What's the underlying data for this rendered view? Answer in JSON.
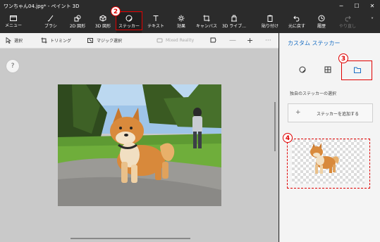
{
  "window": {
    "title": "ワンちゃん04.jpg* - ペイント 3D"
  },
  "ribbon": {
    "menu": "メニュー",
    "brush": "ブラシ",
    "shapes2d": "2D 図形",
    "shapes3d": "3D 図形",
    "stickers": "ステッカー",
    "text": "テキスト",
    "effects": "効果",
    "canvas": "キャンバス",
    "library3d": "3D ライブ...",
    "paste": "貼り付け",
    "undo": "元に戻す",
    "history": "履歴",
    "redo": "やり直し"
  },
  "toolbar": {
    "select": "選択",
    "crop": "トリミング",
    "magic_select": "マジック選択",
    "mixed_reality": "Mixed Reality"
  },
  "panel": {
    "title": "カスタム ステッカー",
    "section_label": "独自のステッカーの選択",
    "add_sticker": "ステッカーを追加する"
  },
  "markers": [
    "2",
    "3",
    "4"
  ],
  "help": "?",
  "colors": {
    "accent": "#1a6fc4",
    "highlight": "#e00000",
    "ribbon_bg": "#2b2b2b",
    "canvas_bg": "#c9c9c9"
  }
}
